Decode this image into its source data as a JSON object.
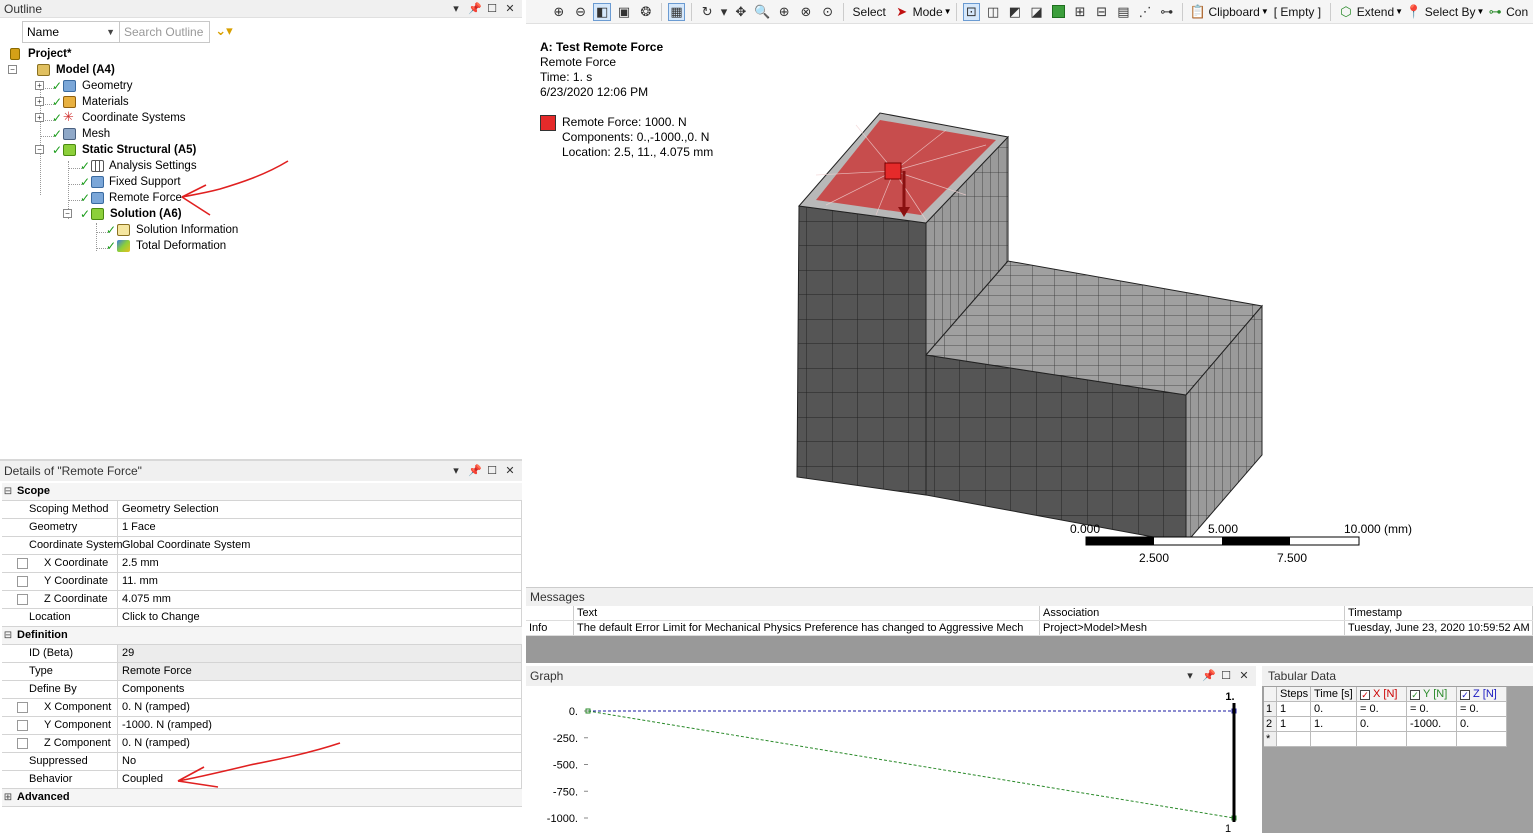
{
  "outline": {
    "title": "Outline",
    "name_filter": "Name",
    "search_placeholder": "Search Outline",
    "tree": {
      "project": "Project*",
      "model": "Model (A4)",
      "geometry": "Geometry",
      "materials": "Materials",
      "coordinate_systems": "Coordinate Systems",
      "mesh": "Mesh",
      "static_structural": "Static Structural (A5)",
      "analysis_settings": "Analysis Settings",
      "fixed_support": "Fixed Support",
      "remote_force": "Remote Force",
      "solution": "Solution (A6)",
      "solution_information": "Solution Information",
      "total_deformation": "Total Deformation"
    }
  },
  "details": {
    "title": "Details of \"Remote Force\"",
    "sections": {
      "scope": "Scope",
      "definition": "Definition",
      "advanced": "Advanced"
    },
    "rows": {
      "scoping_method": {
        "k": "Scoping Method",
        "v": "Geometry Selection"
      },
      "geometry": {
        "k": "Geometry",
        "v": "1 Face"
      },
      "coordinate_system": {
        "k": "Coordinate System",
        "v": "Global Coordinate System"
      },
      "x_coord": {
        "k": "X Coordinate",
        "v": "2.5 mm"
      },
      "y_coord": {
        "k": "Y Coordinate",
        "v": "11. mm"
      },
      "z_coord": {
        "k": "Z Coordinate",
        "v": "4.075 mm"
      },
      "location": {
        "k": "Location",
        "v": "Click to Change"
      },
      "id_beta": {
        "k": "ID (Beta)",
        "v": "29"
      },
      "type": {
        "k": "Type",
        "v": "Remote Force"
      },
      "define_by": {
        "k": "Define By",
        "v": "Components"
      },
      "x_comp": {
        "k": "X Component",
        "v": "0. N  (ramped)"
      },
      "y_comp": {
        "k": "Y Component",
        "v": "-1000. N  (ramped)"
      },
      "z_comp": {
        "k": "Z Component",
        "v": "0. N  (ramped)"
      },
      "suppressed": {
        "k": "Suppressed",
        "v": "No"
      },
      "behavior": {
        "k": "Behavior",
        "v": "Coupled"
      }
    }
  },
  "toolbar": {
    "select": "Select",
    "mode": "Mode",
    "clipboard": "Clipboard",
    "empty": "[ Empty ]",
    "extend": "Extend",
    "select_by": "Select By",
    "con": "Con"
  },
  "viewport": {
    "title": "A: Test Remote Force",
    "subtitle": "Remote Force",
    "time": "Time: 1. s",
    "date": "6/23/2020 12:06 PM",
    "legend_color": "#e52a2a",
    "legend_line1": "Remote Force: 1000. N",
    "legend_line2": "Components: 0.,-1000.,0. N",
    "legend_line3": "Location: 2.5, 11., 4.075 mm",
    "scale": {
      "t0": "0.000",
      "t1": "5.000",
      "t2": "10.000 (mm)",
      "b1": "2.500",
      "b2": "7.500"
    }
  },
  "messages": {
    "title": "Messages",
    "columns": [
      "",
      "Text",
      "Association",
      "Timestamp"
    ],
    "row": [
      "Info",
      "The default Error Limit for Mechanical Physics Preference has changed to Aggressive Mech",
      "Project>Model>Mesh",
      "Tuesday, June 23, 2020 10:59:52 AM"
    ]
  },
  "graph": {
    "title": "Graph",
    "time_label": "1.",
    "time_label_bottom": "1",
    "chart_data": {
      "type": "line",
      "x": [
        0,
        1
      ],
      "series": [
        {
          "values": [
            0,
            0
          ],
          "color": "#1a1aa0"
        },
        {
          "values": [
            0,
            -1000
          ],
          "color": "#2a8a2a"
        }
      ],
      "yticks": [
        "0.",
        "-250.",
        "-500.",
        "-750.",
        "-1000."
      ],
      "ylim": [
        -1000,
        0
      ]
    }
  },
  "tabular": {
    "title": "Tabular Data",
    "headers": [
      "Steps",
      "Time [s]",
      "X [N]",
      "Y [N]",
      "Z [N]"
    ],
    "header_colors": [
      "#000000",
      "#000000",
      "#cc0000",
      "#2a8a2a",
      "#1a1ac0"
    ],
    "rows": [
      [
        "1",
        "1",
        "0.",
        "= 0.",
        "= 0.",
        "= 0."
      ],
      [
        "2",
        "1",
        "1.",
        "0.",
        "-1000.",
        "0."
      ],
      [
        "*",
        "",
        "",
        "",
        "",
        ""
      ]
    ]
  }
}
